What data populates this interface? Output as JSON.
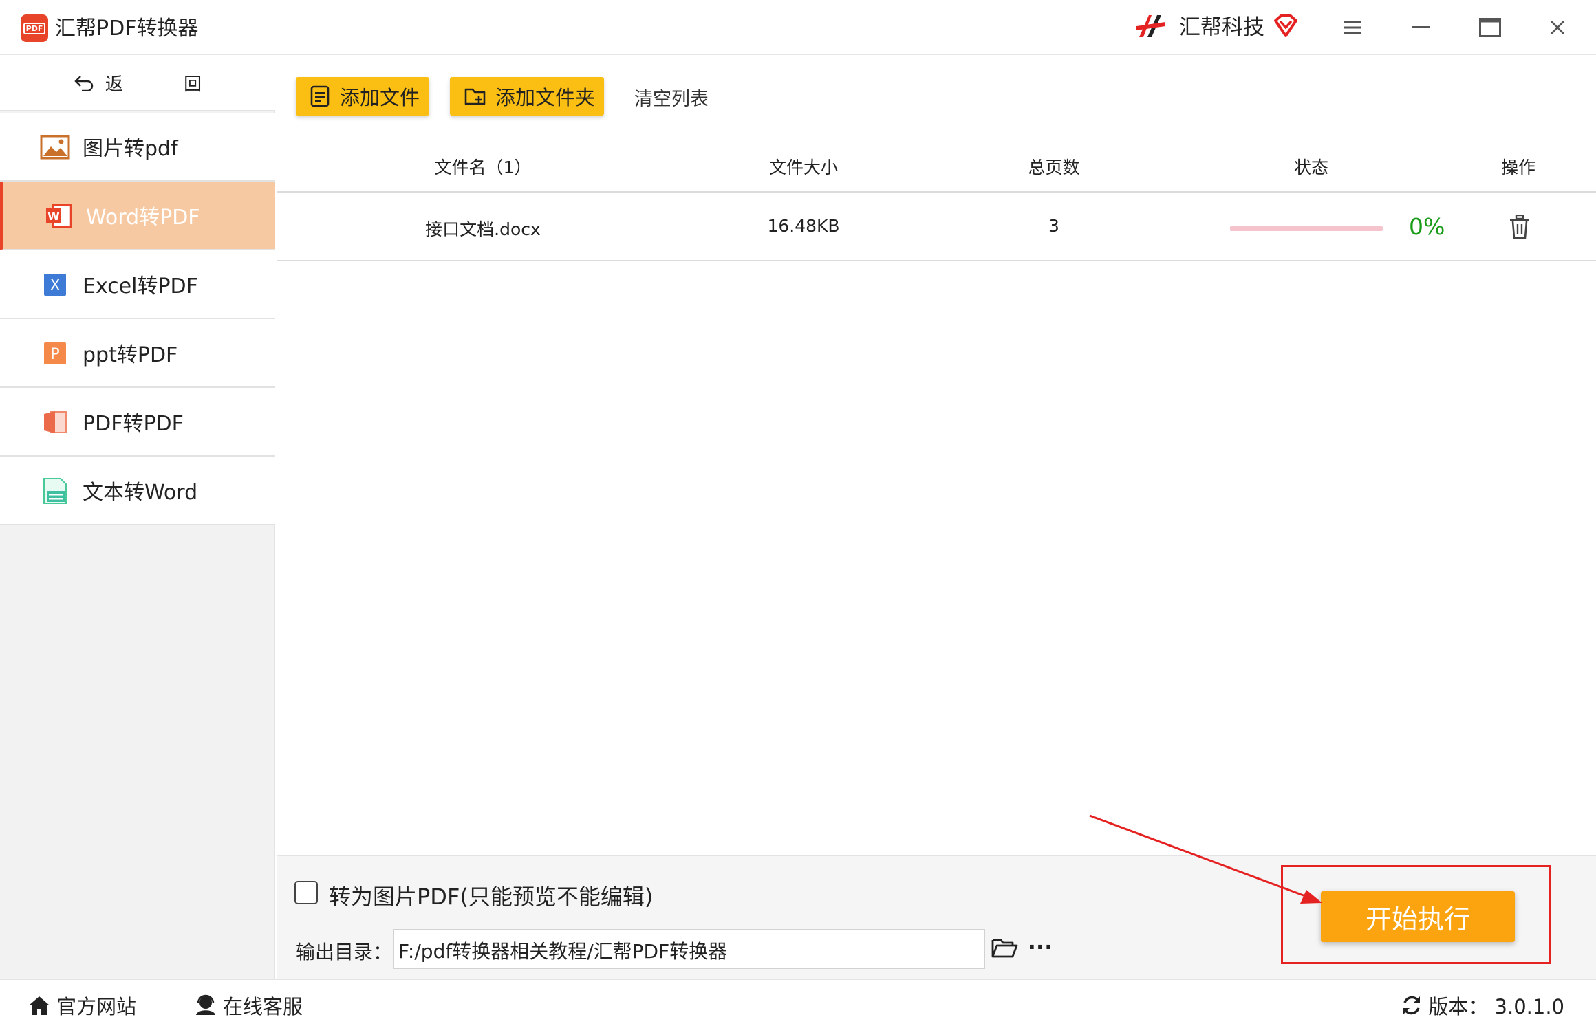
{
  "window": {
    "title": "汇帮PDF转换器",
    "logo_text": "PDF",
    "brand": "汇帮科技"
  },
  "sidebar": {
    "back_label": "返 回",
    "items": [
      {
        "label": "图片转pdf",
        "icon": "image-icon",
        "active": false
      },
      {
        "label": "Word转PDF",
        "icon": "word-icon",
        "active": true
      },
      {
        "label": "Excel转PDF",
        "icon": "excel-icon",
        "active": false
      },
      {
        "label": "ppt转PDF",
        "icon": "ppt-icon",
        "active": false
      },
      {
        "label": "PDF转PDF",
        "icon": "pdf-icon",
        "active": false
      },
      {
        "label": "文本转Word",
        "icon": "text-icon",
        "active": false
      }
    ],
    "excel_glyph": "X",
    "ppt_glyph": "P",
    "word_glyph": "W"
  },
  "toolbar": {
    "add_file": "添加文件",
    "add_folder": "添加文件夹",
    "clear_list": "清空列表"
  },
  "table": {
    "headers": {
      "name": "文件名（1）",
      "size": "文件大小",
      "pages": "总页数",
      "status": "状态",
      "action": "操作"
    },
    "rows": [
      {
        "name": "接口文档.docx",
        "size": "16.48KB",
        "pages": "3",
        "progress": 0,
        "progress_text": "0%"
      }
    ]
  },
  "options": {
    "image_pdf_label": "转为图片PDF(只能预览不能编辑)",
    "image_pdf_checked": false,
    "output_label": "输出目录：",
    "output_path": "F:/pdf转换器相关教程/汇帮PDF转换器",
    "more_label": "···",
    "start_button": "开始执行"
  },
  "footer": {
    "website": "官方网站",
    "support": "在线客服",
    "version": "版本：  3.0.1.0"
  },
  "colors": {
    "accent": "#e8442a",
    "toolbar_button": "#fbbf14",
    "start_button": "#fba40f",
    "active_nav": "#f7c9a2",
    "progress_text": "#1a9c1a",
    "annotation": "#e52222"
  }
}
